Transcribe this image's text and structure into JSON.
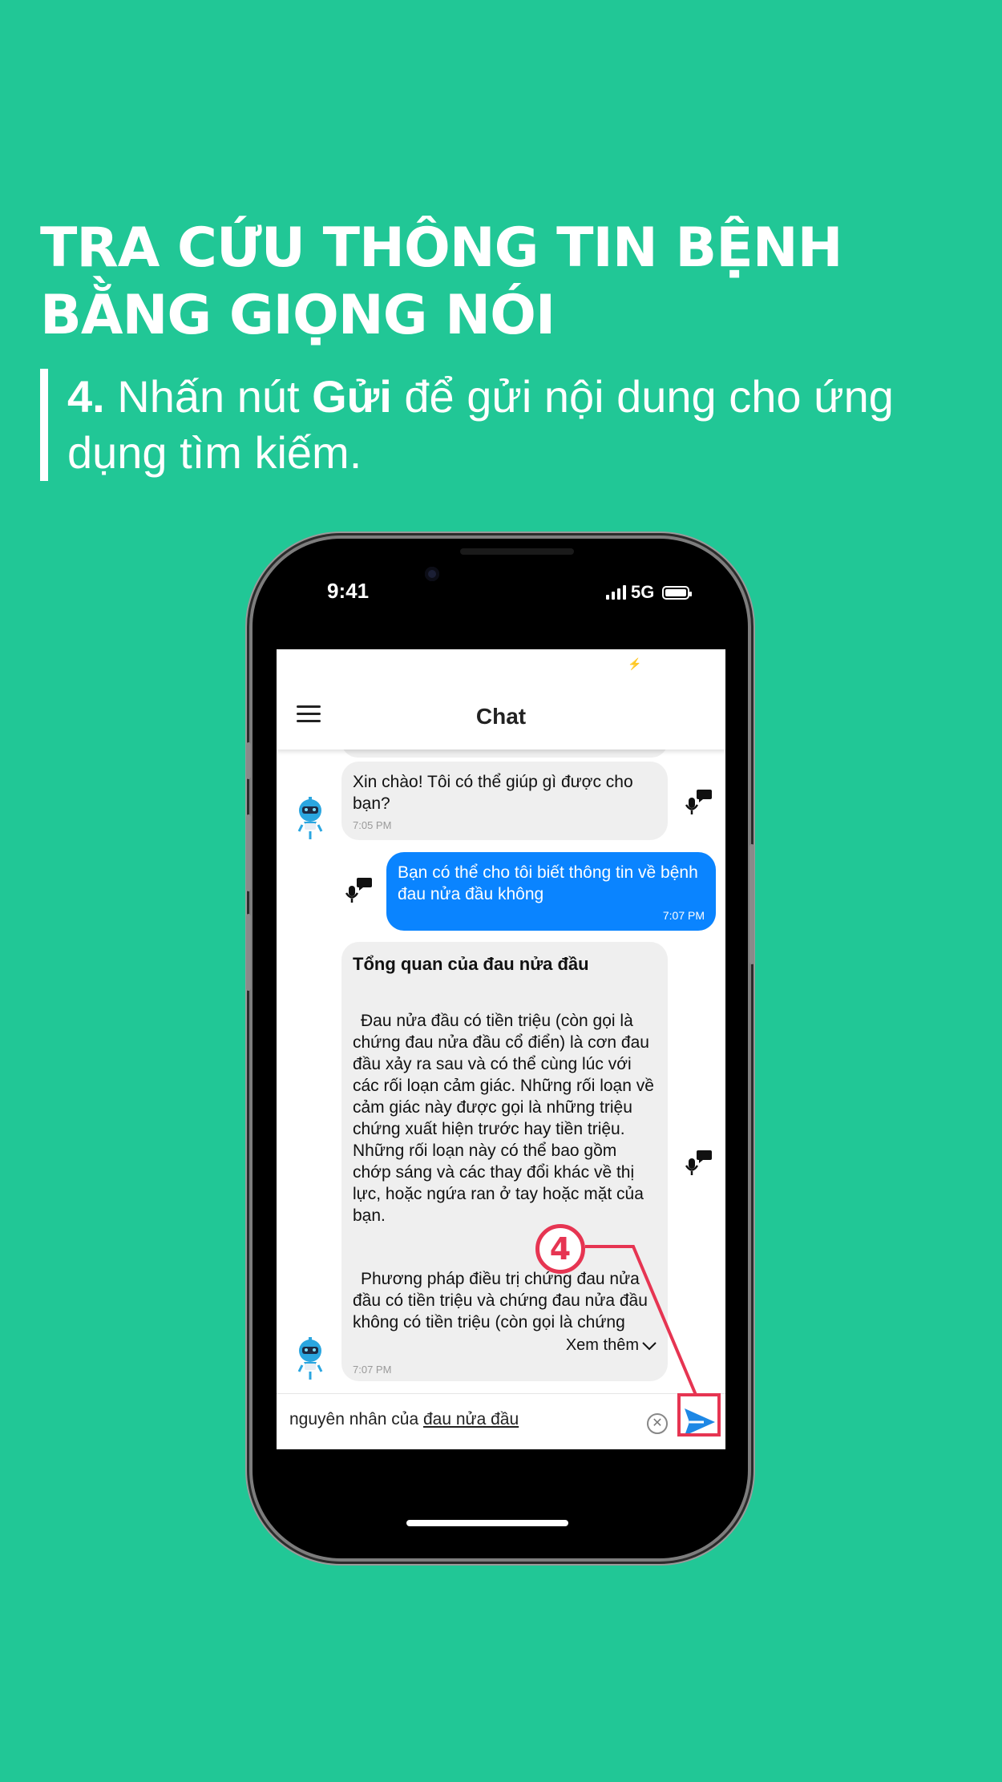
{
  "heading": "TRA CỨU THÔNG TIN BỆNH BẰNG GIỌNG NÓI",
  "step": {
    "number": "4.",
    "text_before": "Nhấn nút",
    "bold": "Gửi",
    "text_after": "để gửi nội dung cho ứng dụng tìm kiếm."
  },
  "status_bar": {
    "time": "9:41",
    "network": "5G"
  },
  "app": {
    "title": "Chat",
    "messages": [
      {
        "sender": "bot",
        "text": "Xin chào! Tôi có thể giúp gì được cho bạn?",
        "time": "7:05 PM"
      },
      {
        "sender": "user",
        "text": "Bạn có thể cho tôi biết thông tin về bệnh đau nửa đầu không",
        "time": "7:07 PM"
      },
      {
        "sender": "bot",
        "title": "Tổng quan của đau nửa đầu",
        "paragraph1": "Đau nửa đầu có tiền triệu (còn gọi là chứng đau nửa đầu cổ điển) là cơn đau đầu xảy ra sau và có thể cùng lúc với các rối loạn cảm giác. Những rối loạn về cảm giác này được gọi là những triệu chứng xuất hiện trước hay tiền triệu. Những rối loạn này có thể bao gồm chớp sáng và các thay đổi khác về thị lực, hoặc ngứa ran ở tay hoặc mặt của bạn.",
        "paragraph2": "Phương pháp điều trị chứng đau nửa đầu có tiền triệu và chứng đau nửa đầu không có tiền triệu (còn gọi là chứng đau",
        "more": "Xem thêm",
        "time": "7:07 PM"
      }
    ],
    "input": {
      "prefix": "nguyên nhân của",
      "underlined": "đau nửa đầu"
    }
  },
  "callout": {
    "label": "4",
    "color": "#e63552"
  },
  "colors": {
    "background": "#21c796",
    "user_bubble": "#0a84ff",
    "bot_bubble": "#efefef",
    "send": "#1e88e5"
  },
  "icons": [
    "menu-icon",
    "microphone-speech-icon",
    "robot-avatar-icon",
    "clear-icon",
    "send-icon",
    "chevron-down-icon"
  ]
}
